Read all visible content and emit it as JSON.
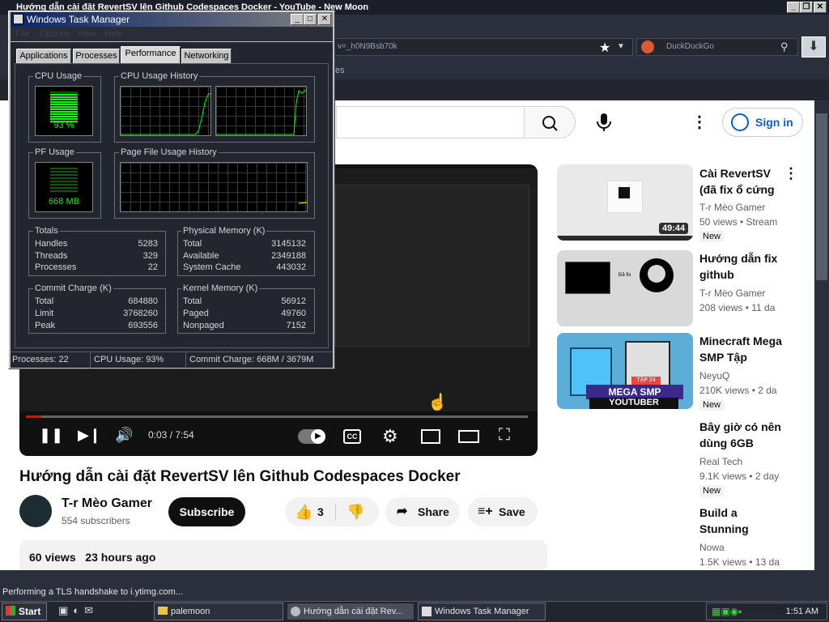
{
  "browser": {
    "window_title": "Hướng dẫn cài đặt RevertSV lên Github Codespaces Docker - YouTube - New Moon",
    "url_fragment": "v=_h0N9Bsb70k",
    "search_engine": "DuckDuckGo",
    "bookmark_fragment": "es",
    "status": "Performing a TLS handshake to i.ytimg.com..."
  },
  "youtube": {
    "sign_in": "Sign in",
    "video": {
      "title": "Hướng dẫn cài đặt RevertSV lên Github Codespaces Docker",
      "time": "0:03 / 7:54",
      "progress_fraction": 0.006
    },
    "channel": {
      "name": "T-r Mèo Gamer",
      "subscribers": "554 subscribers"
    },
    "subscribe": "Subscribe",
    "likes": "3",
    "share": "Share",
    "save": "Save",
    "description": {
      "views": "60 views",
      "age": "23 hours ago"
    },
    "recommendations": [
      {
        "title": "Cài RevertSV (đã fix ổ cứng",
        "channel": "T-r Mèo Gamer",
        "meta": "50 views • Stream",
        "badge": "New",
        "duration": "49:44"
      },
      {
        "title": "Hướng dẫn fix github",
        "channel": "T-r Mèo Gamer",
        "meta": "208 views • 11 da",
        "badge": "",
        "duration": ""
      },
      {
        "title": "Minecraft Mega SMP Tập",
        "channel": "NeyuQ",
        "meta": "210K views • 2 da",
        "badge": "New",
        "duration": ""
      },
      {
        "title": "Bây giờ có nên dùng 6GB",
        "channel": "Real Tech",
        "meta": "9.1K views • 2 day",
        "badge": "New",
        "duration": ""
      },
      {
        "title": "Build a Stunning",
        "channel": "Nowa",
        "meta": "1.5K views • 13 da",
        "badge": "",
        "duration": ""
      }
    ],
    "thumb_texts": {
      "tb2_left": "Đã fix",
      "tb3_banner": "MEGA SMP",
      "tb3_sub": "YOUTUBER",
      "tb3_tag": "TẬP 24"
    }
  },
  "taskmgr": {
    "title": "Windows Task Manager",
    "menu": [
      "File",
      "Options",
      "View",
      "Help"
    ],
    "tabs": [
      "Applications",
      "Processes",
      "Performance",
      "Networking"
    ],
    "selected_tab": "Performance",
    "cpu_usage_label": "CPU Usage",
    "cpu_usage_value": "93 %",
    "cpu_usage_fraction": 0.93,
    "cpu_history_label": "CPU Usage History",
    "pf_usage_label": "PF Usage",
    "pf_usage_value": "668 MB",
    "pf_history_label": "Page File Usage History",
    "totals": {
      "label": "Totals",
      "rows": [
        [
          "Handles",
          "5283"
        ],
        [
          "Threads",
          "329"
        ],
        [
          "Processes",
          "22"
        ]
      ]
    },
    "physical": {
      "label": "Physical Memory (K)",
      "rows": [
        [
          "Total",
          "3145132"
        ],
        [
          "Available",
          "2349188"
        ],
        [
          "System Cache",
          "443032"
        ]
      ]
    },
    "commit": {
      "label": "Commit Charge (K)",
      "rows": [
        [
          "Total",
          "684880"
        ],
        [
          "Limit",
          "3768260"
        ],
        [
          "Peak",
          "693556"
        ]
      ]
    },
    "kernel": {
      "label": "Kernel Memory (K)",
      "rows": [
        [
          "Total",
          "56912"
        ],
        [
          "Paged",
          "49760"
        ],
        [
          "Nonpaged",
          "7152"
        ]
      ]
    },
    "status": {
      "processes": "Processes: 22",
      "cpu": "CPU Usage: 93%",
      "commit": "Commit Charge: 668M / 3679M"
    }
  },
  "taskbar": {
    "start": "Start",
    "tasks": [
      "palemoon",
      "Hướng dẫn cài đặt Rev...",
      "Windows Task Manager"
    ],
    "clock": "1:51 AM"
  }
}
